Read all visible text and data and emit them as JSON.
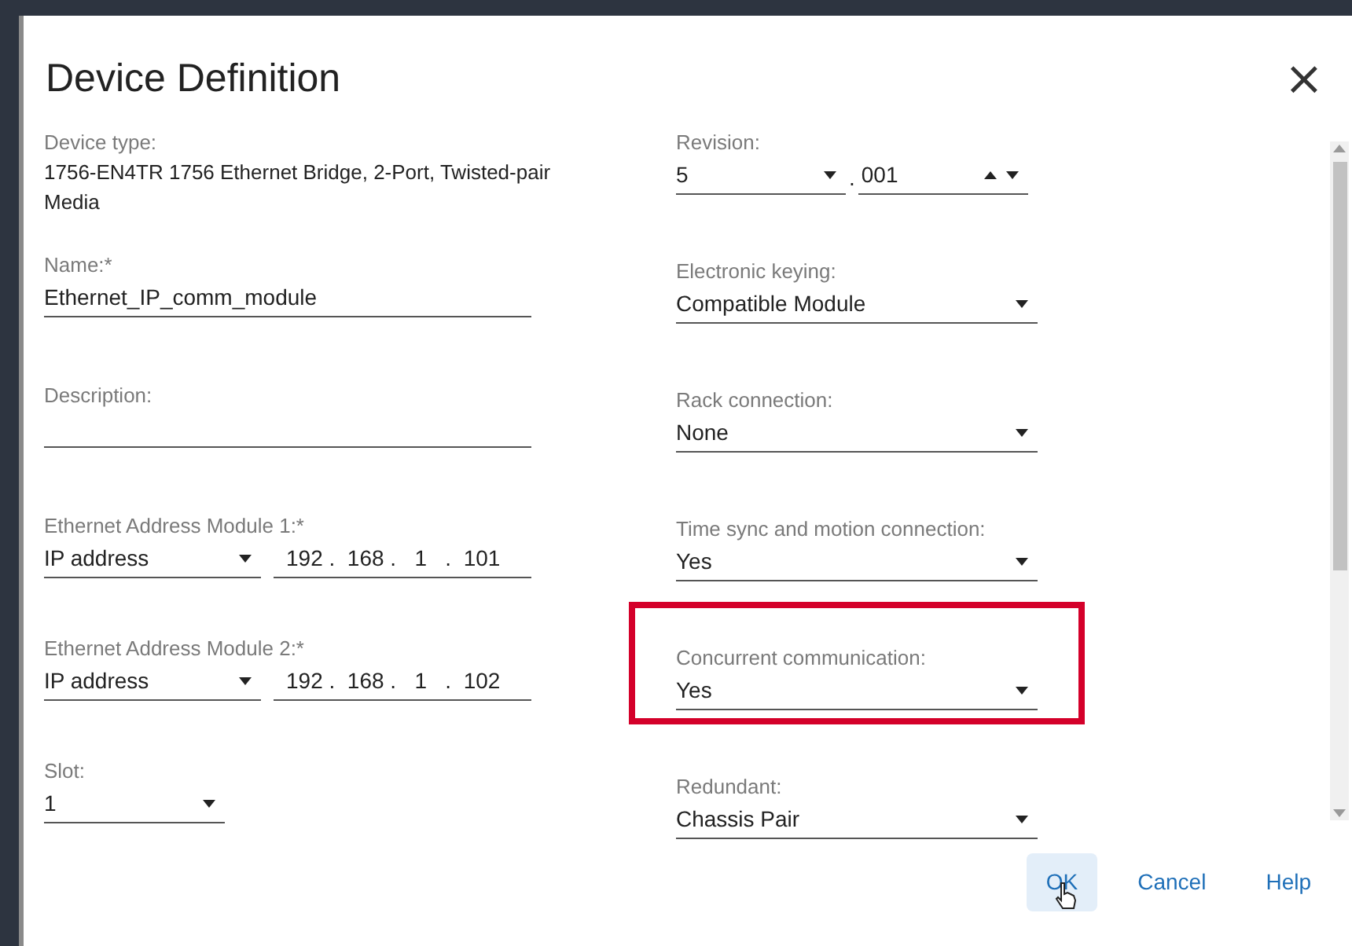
{
  "dialog": {
    "title": "Device Definition",
    "close": "×"
  },
  "left_fields": [
    {
      "kind": "text",
      "label": "Device type:",
      "value": "1756-EN4TR 1756 Ethernet Bridge, 2-Port, Twisted-pair Media"
    },
    {
      "kind": "input",
      "label": "Name:*",
      "value": "Ethernet_IP_comm_module"
    },
    {
      "kind": "input",
      "label": "Description:"
    },
    {
      "kind": "ip",
      "label": "Ethernet Address Module 1:*",
      "value": "IP address",
      "address": "192 .  168 .   1   .  101"
    },
    {
      "kind": "ip",
      "label": "Ethernet Address Module 2:*",
      "value": "IP address",
      "address": "192 .  168 .   1   .  102"
    },
    {
      "kind": "select",
      "label": "Slot:",
      "value": "1",
      "narrow": true
    }
  ],
  "right_fields": [
    {
      "kind": "revision",
      "label": "Revision:",
      "major": "5",
      "separator": ".",
      "minor": "001",
      "highlighted": false
    },
    {
      "kind": "select",
      "label": "Electronic keying:",
      "value": "Compatible Module",
      "highlighted": false
    },
    {
      "kind": "select",
      "label": "Rack connection:",
      "value": "None",
      "highlighted": false
    },
    {
      "kind": "select",
      "label": "Time sync and motion connection:",
      "value": "Yes",
      "highlighted": false
    },
    {
      "kind": "select",
      "label": "Concurrent communication:",
      "value": "Yes",
      "highlighted": true
    },
    {
      "kind": "select",
      "label": "Redundant:",
      "value": "Chassis Pair",
      "highlighted": false
    }
  ],
  "buttons": [
    {
      "label": "OK",
      "hovered": true
    },
    {
      "label": "Cancel",
      "hovered": false
    },
    {
      "label": "Help",
      "hovered": false
    }
  ]
}
